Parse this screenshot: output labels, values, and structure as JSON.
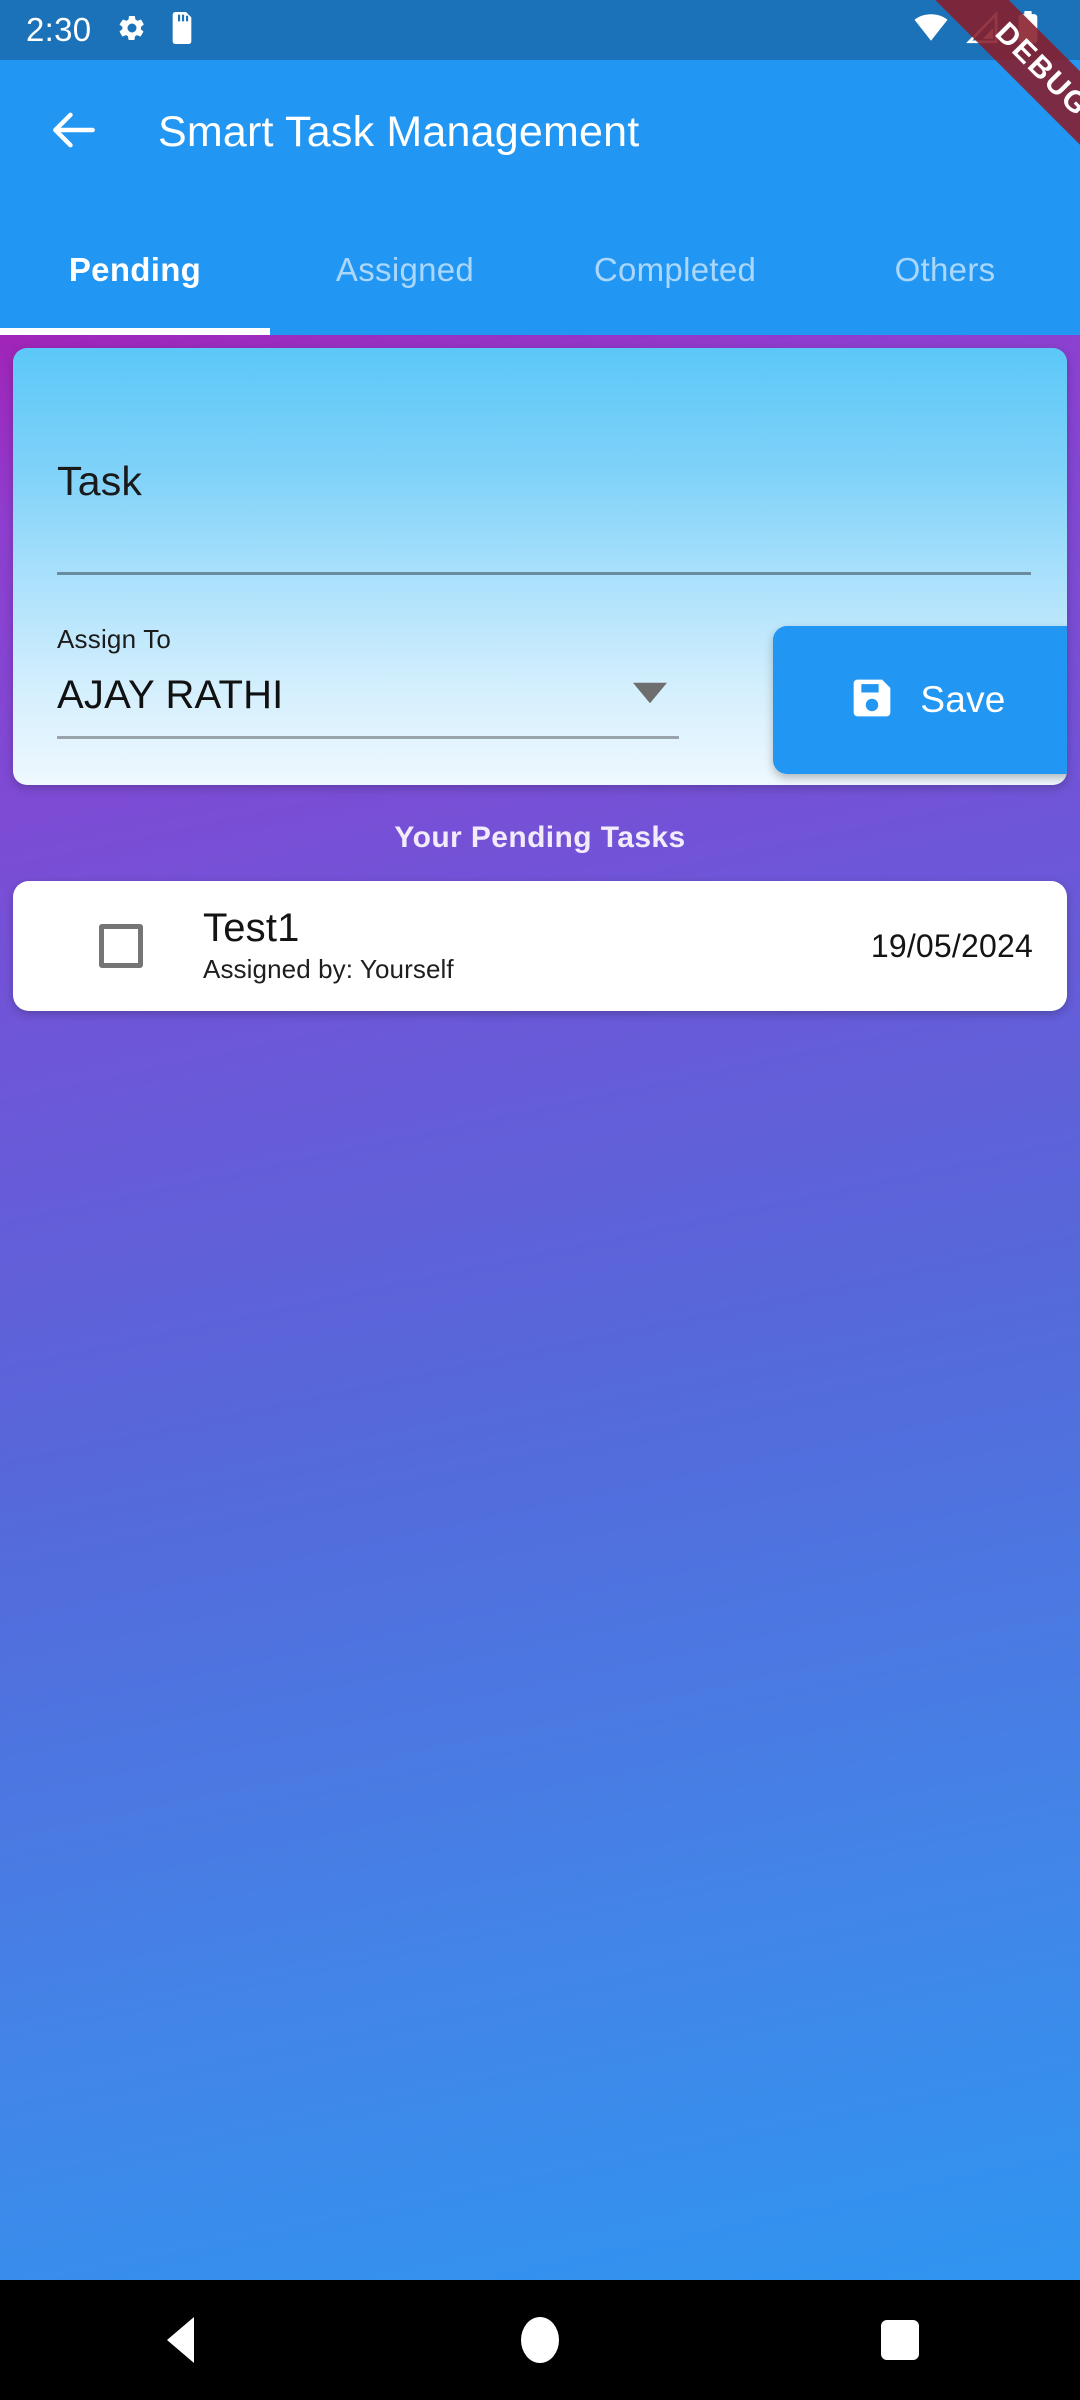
{
  "status_bar": {
    "clock": "2:30",
    "left_icons": [
      "gear-icon",
      "sd-card-icon"
    ],
    "right_icons": [
      "wifi-icon",
      "cellular-signal-icon",
      "battery-icon"
    ],
    "background_color": "#1B72B8"
  },
  "debug_banner": {
    "label": "DEBUG",
    "color": "#871C2A"
  },
  "app_bar": {
    "back_icon": "arrow-left-icon",
    "title": "Smart Task Management",
    "background_color": "#2196F3"
  },
  "tabs": {
    "active_index": 0,
    "items": [
      {
        "label": "Pending"
      },
      {
        "label": "Assigned"
      },
      {
        "label": "Completed"
      },
      {
        "label": "Others"
      }
    ]
  },
  "form_card": {
    "task_field": {
      "label": "Task",
      "value": "",
      "placeholder": "Task"
    },
    "assign_to": {
      "label": "Assign To",
      "selected": "AJAY RATHI",
      "chevron_icon": "chevron-down-icon"
    },
    "save_button": {
      "label": "Save",
      "icon": "save-floppy-icon",
      "color": "#2196F3"
    },
    "gradient_from": "#5CC8F8",
    "gradient_to": "#EFF8FE"
  },
  "pending_section": {
    "header": "Your Pending Tasks",
    "tasks": [
      {
        "checked": false,
        "title": "Test1",
        "subtitle": "Assigned by: Yourself",
        "date": "19/05/2024"
      }
    ]
  },
  "background": {
    "gradient_from": "#A124B8",
    "gradient_to": "#2F95F0"
  },
  "nav_bar": {
    "buttons": [
      "back-triangle-icon",
      "home-circle-icon",
      "recents-square-icon"
    ],
    "background_color": "#000000"
  }
}
